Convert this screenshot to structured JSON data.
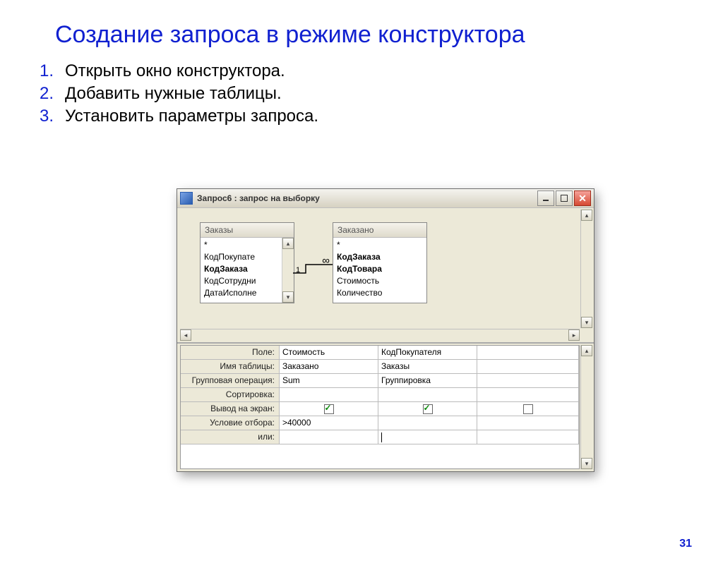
{
  "title": "Создание запроса в режиме конструктора",
  "steps": [
    "Открыть окно конструктора.",
    "Добавить нужные таблицы.",
    "Установить параметры запроса."
  ],
  "page_number": "31",
  "window": {
    "title": "Запрос6 : запрос на выборку",
    "tables": {
      "left": {
        "name": "Заказы",
        "fields": [
          "*",
          "КодПокупате",
          "КодЗаказа",
          "КодСотрудни",
          "ДатаИсполне"
        ],
        "bold_indices": [
          2
        ],
        "has_scroll": true
      },
      "right": {
        "name": "Заказано",
        "fields": [
          "*",
          "КодЗаказа",
          "КодТовара",
          "Стоимость",
          "Количество"
        ],
        "bold_indices": [
          1,
          2
        ],
        "has_scroll": false
      }
    },
    "relation": {
      "one": "1",
      "many": "∞"
    },
    "grid": {
      "rows": [
        {
          "label": "Поле:",
          "c1": "Стоимость",
          "c2": "КодПокупателя"
        },
        {
          "label": "Имя таблицы:",
          "c1": "Заказано",
          "c2": "Заказы"
        },
        {
          "label": "Групповая операция:",
          "c1": "Sum",
          "c2": "Группировка"
        },
        {
          "label": "Сортировка:",
          "c1": "",
          "c2": ""
        },
        {
          "label": "Вывод на экран:",
          "c1_check": true,
          "c2_check": true
        },
        {
          "label": "Условие отбора:",
          "c1": ">40000",
          "c2": ""
        },
        {
          "label": "или:",
          "c1": "",
          "c2_cursor": true
        }
      ]
    }
  }
}
